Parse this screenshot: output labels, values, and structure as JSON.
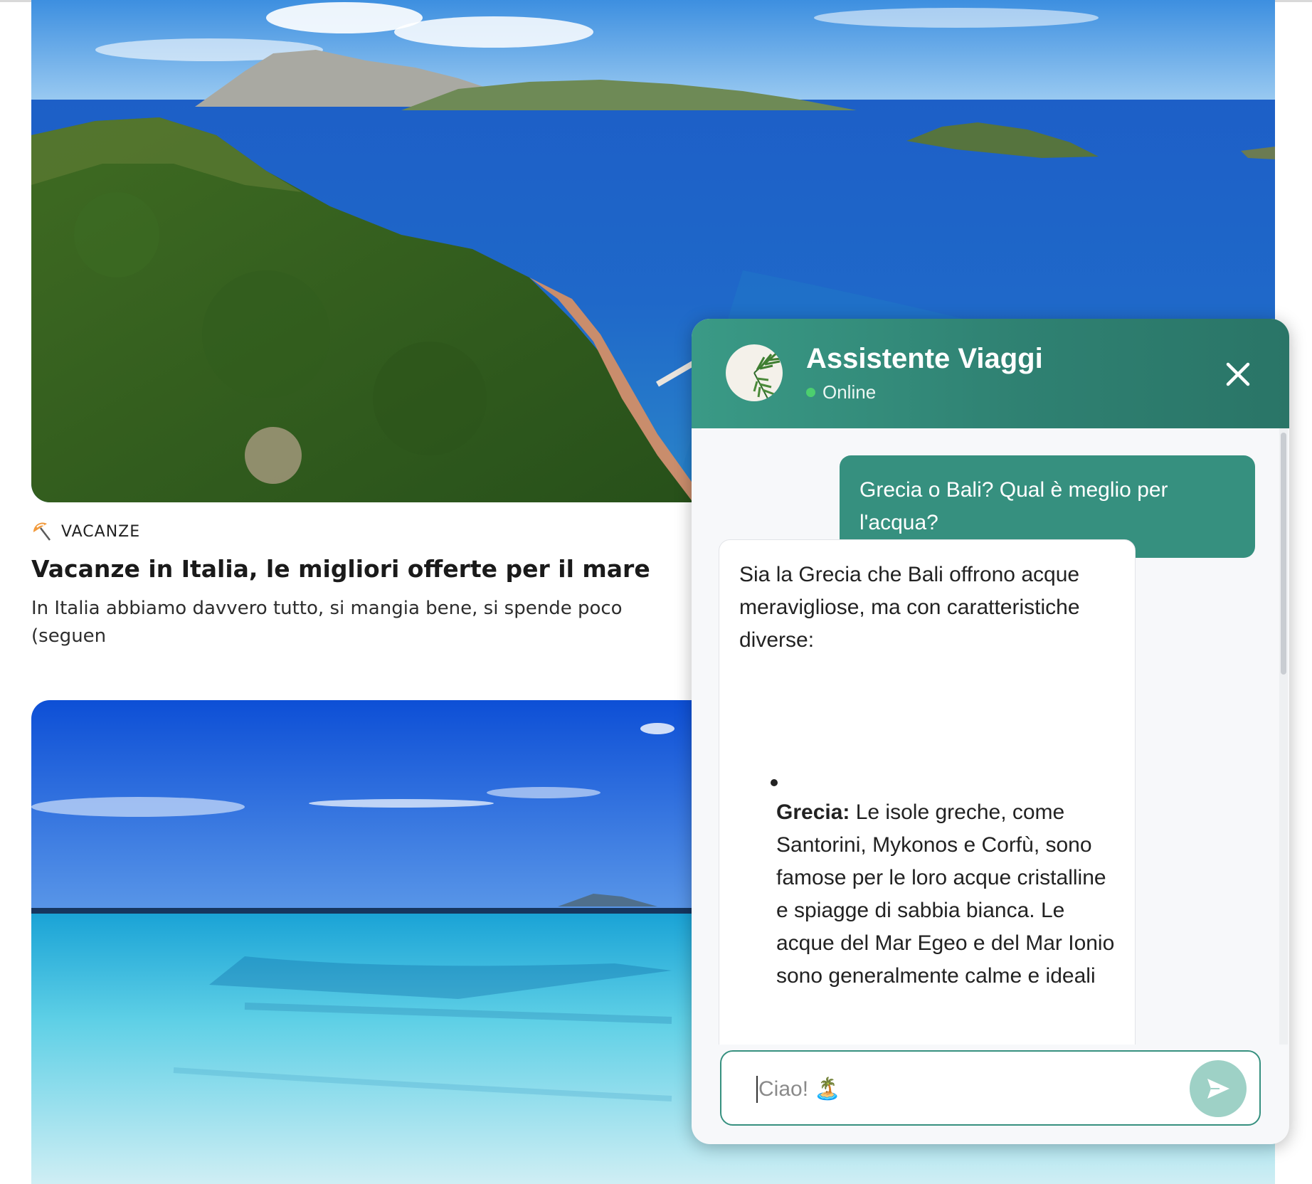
{
  "article": {
    "category": "VACANZE",
    "title": "Vacanze in Italia, le migliori offerte per il mare",
    "excerpt": "In Italia abbiamo davvero tutto, si mangia bene, si spende poco (seguen\nspostarsi... Ma..."
  },
  "chat": {
    "agent_name": "Assistente Viaggi",
    "status": "Online",
    "colors": {
      "header": "#2f8172",
      "user_bubble": "#36907f",
      "status_dot": "#4ccf6e",
      "send": "#9ed1c6"
    },
    "messages": {
      "user": "Grecia o Bali? Qual è meglio per l'acqua?",
      "bot_intro": "Sia la Grecia che Bali offrono acque meravigliose, ma con caratteristiche diverse:",
      "bot_item_term": "Grecia:",
      "bot_item_text": " Le isole greche, come Santorini, Mykonos e Corfù, sono famose per le loro acque cristalline e spiagge di sabbia bianca. Le acque del Mar Egeo e del Mar Ionio sono generalmente calme e ideali"
    },
    "input": {
      "placeholder": "Ciao! 🏝️"
    },
    "icons": {
      "close": "close-icon",
      "send": "send-icon",
      "avatar": "palm-leaf-icon",
      "category": "beach-umbrella-icon"
    }
  }
}
